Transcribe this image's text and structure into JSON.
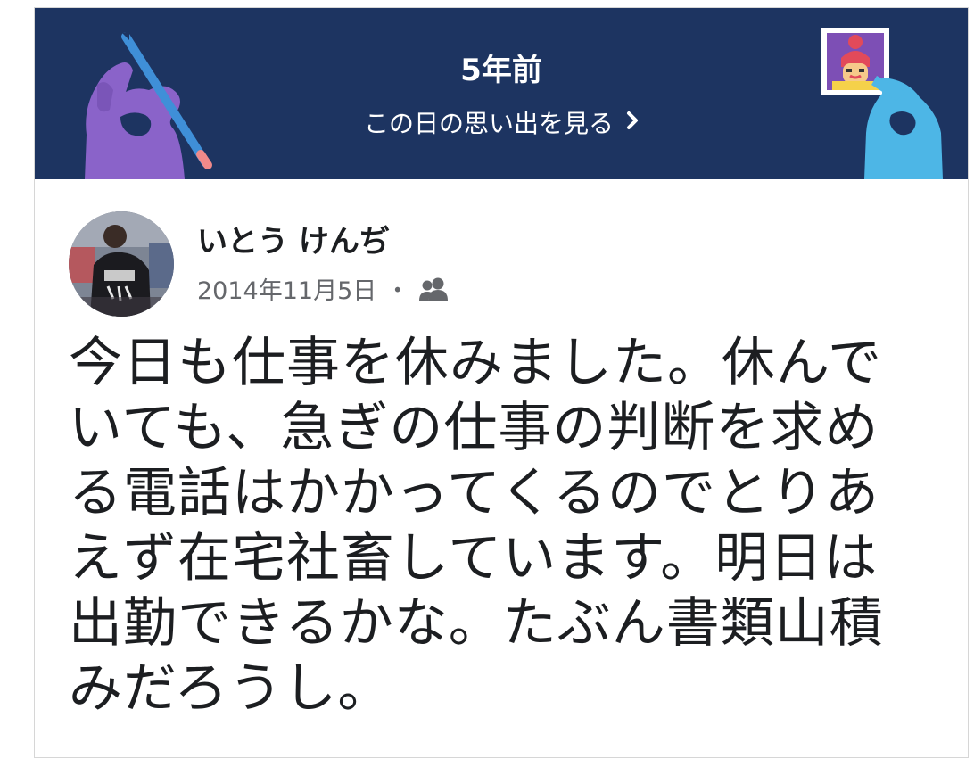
{
  "memory": {
    "title": "5年前",
    "link_label": "この日の思い出を見る",
    "chevron_icon": "chevron-right-icon",
    "colors": {
      "banner_bg": "#1d3461",
      "left_hand": "#8a63c9",
      "right_hand": "#4db6e6",
      "pencil": "#3f8fd8"
    }
  },
  "post": {
    "author": "いとう けんぢ",
    "date": "2014年11月5日",
    "separator": "・",
    "audience_icon": "friends-icon",
    "text": "今日も仕事を休みました。休んでいても、急ぎの仕事の判断を求める電話はかかってくるのでとりあえず在宅社畜しています。明日は出勤できるかな。たぶん書類山積みだろうし。"
  }
}
